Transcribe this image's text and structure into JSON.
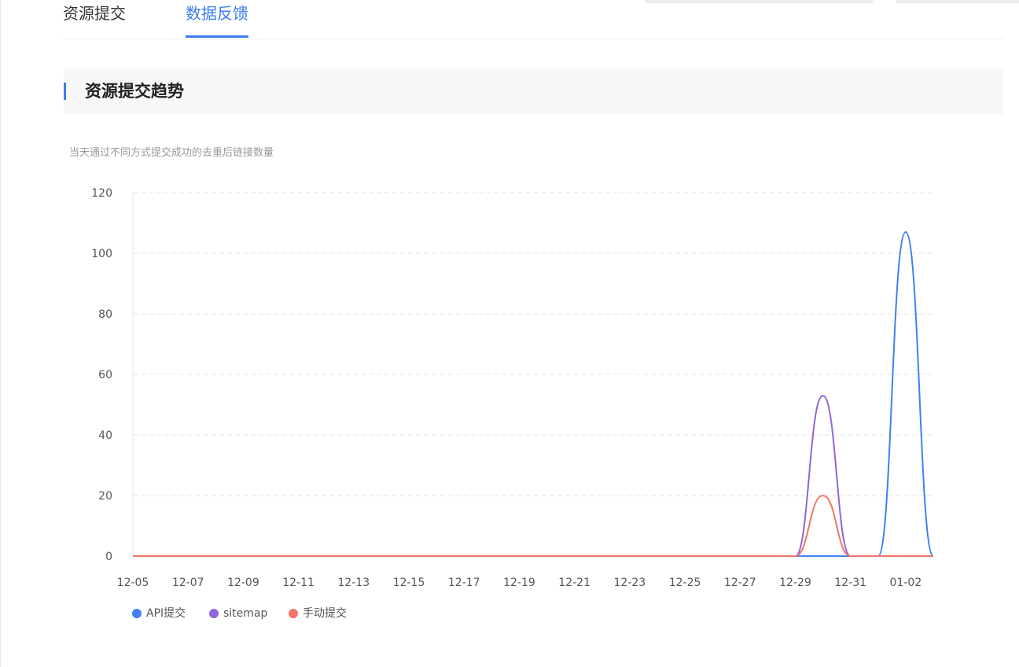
{
  "tabs": [
    {
      "label": "资源提交",
      "active": false
    },
    {
      "label": "数据反馈",
      "active": true
    }
  ],
  "section": {
    "title": "资源提交趋势"
  },
  "chart_subtitle": "当天通过不同方式提交成功的去重后链接数量",
  "colors": {
    "accent": "#3b7ded",
    "api": "#4080f0",
    "sitemap": "#9166d9",
    "manual": "#f1766a"
  },
  "chart_data": {
    "type": "line",
    "title": "",
    "xlabel": "",
    "ylabel": "",
    "ylim": [
      0,
      120
    ],
    "yticks": [
      0,
      20,
      40,
      60,
      80,
      100,
      120
    ],
    "grid": true,
    "legend_position": "bottom-left",
    "x": [
      "12-05",
      "12-06",
      "12-07",
      "12-08",
      "12-09",
      "12-10",
      "12-11",
      "12-12",
      "12-13",
      "12-14",
      "12-15",
      "12-16",
      "12-17",
      "12-18",
      "12-19",
      "12-20",
      "12-21",
      "12-22",
      "12-23",
      "12-24",
      "12-25",
      "12-26",
      "12-27",
      "12-28",
      "12-29",
      "12-30",
      "12-31",
      "01-01",
      "01-02",
      "01-03"
    ],
    "xtick_labels": [
      "12-05",
      "12-07",
      "12-09",
      "12-11",
      "12-13",
      "12-15",
      "12-17",
      "12-19",
      "12-21",
      "12-23",
      "12-25",
      "12-27",
      "12-29",
      "12-31",
      "01-02"
    ],
    "series": [
      {
        "name": "API提交",
        "color": "#4080f0",
        "values": [
          0,
          0,
          0,
          0,
          0,
          0,
          0,
          0,
          0,
          0,
          0,
          0,
          0,
          0,
          0,
          0,
          0,
          0,
          0,
          0,
          0,
          0,
          0,
          0,
          0,
          0,
          0,
          0,
          107,
          0
        ]
      },
      {
        "name": "sitemap",
        "color": "#9166d9",
        "values": [
          0,
          0,
          0,
          0,
          0,
          0,
          0,
          0,
          0,
          0,
          0,
          0,
          0,
          0,
          0,
          0,
          0,
          0,
          0,
          0,
          0,
          0,
          0,
          0,
          0,
          53,
          0,
          0,
          0,
          0
        ]
      },
      {
        "name": "手动提交",
        "color": "#f1766a",
        "values": [
          0,
          0,
          0,
          0,
          0,
          0,
          0,
          0,
          0,
          0,
          0,
          0,
          0,
          0,
          0,
          0,
          0,
          0,
          0,
          0,
          0,
          0,
          0,
          0,
          0,
          20,
          0,
          0,
          0,
          0
        ]
      }
    ]
  }
}
